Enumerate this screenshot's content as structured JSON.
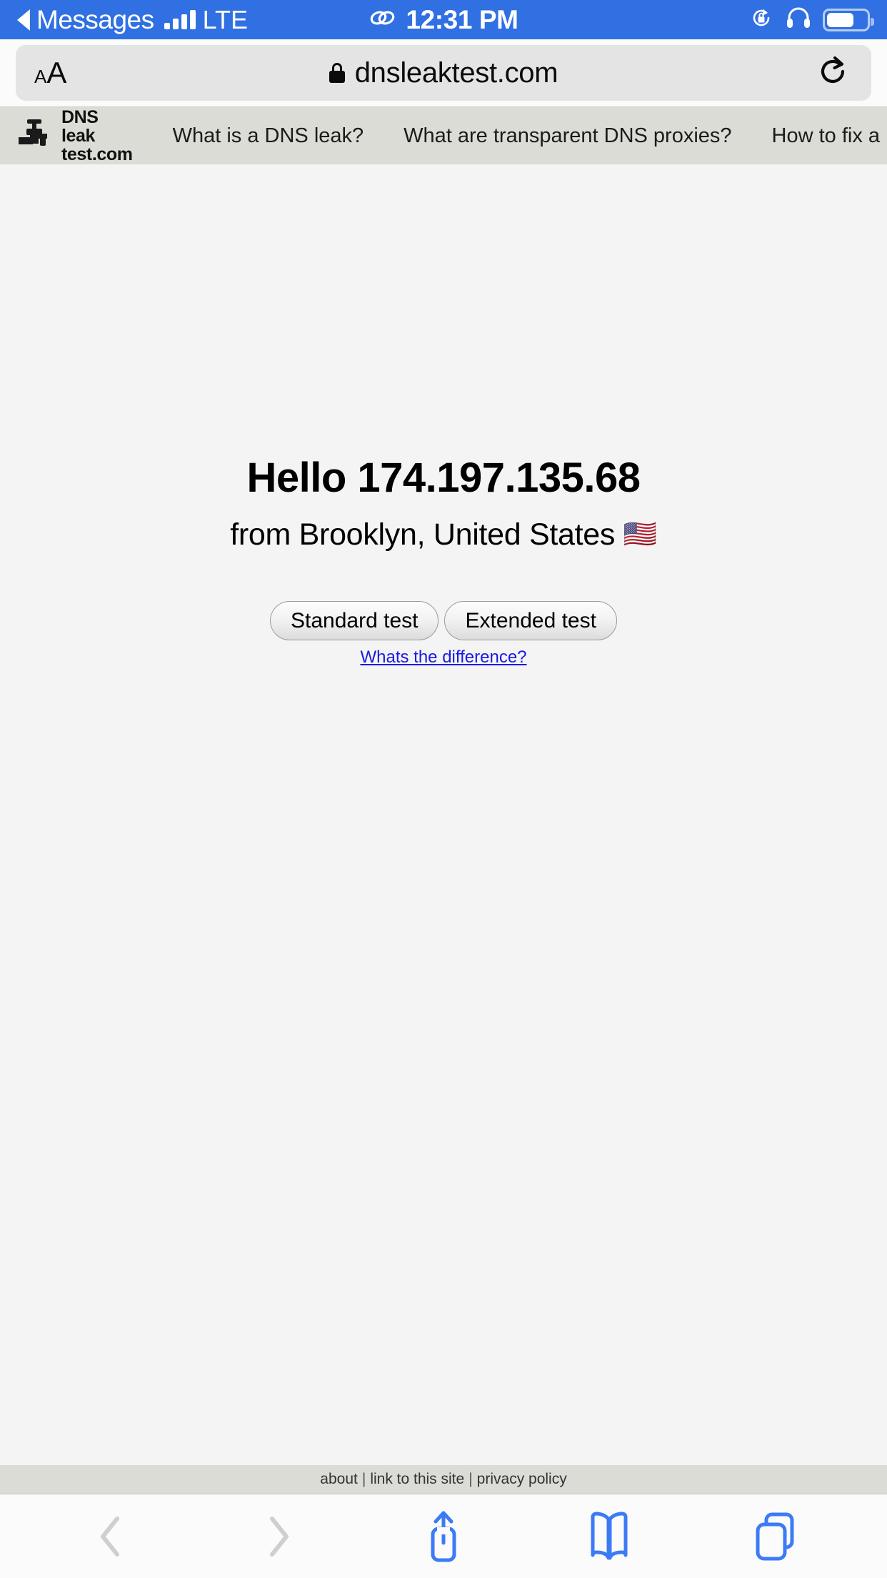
{
  "status_bar": {
    "back_app": "Messages",
    "back_icon": "back-triangle-icon",
    "signal_icon": "cellular-signal-icon",
    "carrier": "LTE",
    "link_icon": "chain-link-icon",
    "time": "12:31 PM",
    "rotation_lock_icon": "rotation-lock-icon",
    "headphones_icon": "headphones-icon",
    "battery_icon": "battery-icon",
    "background_color": "#3070e2"
  },
  "browser": {
    "text_size_label_small": "A",
    "text_size_label_large": "A",
    "lock_icon": "lock-icon",
    "url": "dnsleaktest.com",
    "reload_icon": "reload-icon",
    "toolbar": {
      "back_icon": "chevron-left-icon",
      "forward_icon": "chevron-right-icon",
      "share_icon": "share-icon",
      "bookmarks_icon": "book-icon",
      "tabs_icon": "tabs-icon",
      "accent_color": "#3b7bf5",
      "disabled_color": "#cfcfcf"
    }
  },
  "site": {
    "nav_background": "#dcdcd6",
    "brand": {
      "icon": "faucet-icon",
      "line1": "DNS leak",
      "line2": "test.com"
    },
    "nav_links": [
      {
        "label": "What is a DNS leak?"
      },
      {
        "label": "What are transparent DNS proxies?"
      },
      {
        "label": "How to fix a DNS leak"
      }
    ],
    "hero": {
      "greeting": "Hello 174.197.135.68",
      "location": "from Brooklyn, United States",
      "flag": "🇺🇸"
    },
    "actions": {
      "standard_test": "Standard test",
      "extended_test": "Extended test",
      "difference_link": "Whats the difference?",
      "link_color": "#1919e6"
    },
    "footer": {
      "about": "about",
      "sep1": "|",
      "link_to_site": "link to this site",
      "sep2": "|",
      "privacy": "privacy policy"
    },
    "page_background": "#f4f4f4"
  }
}
